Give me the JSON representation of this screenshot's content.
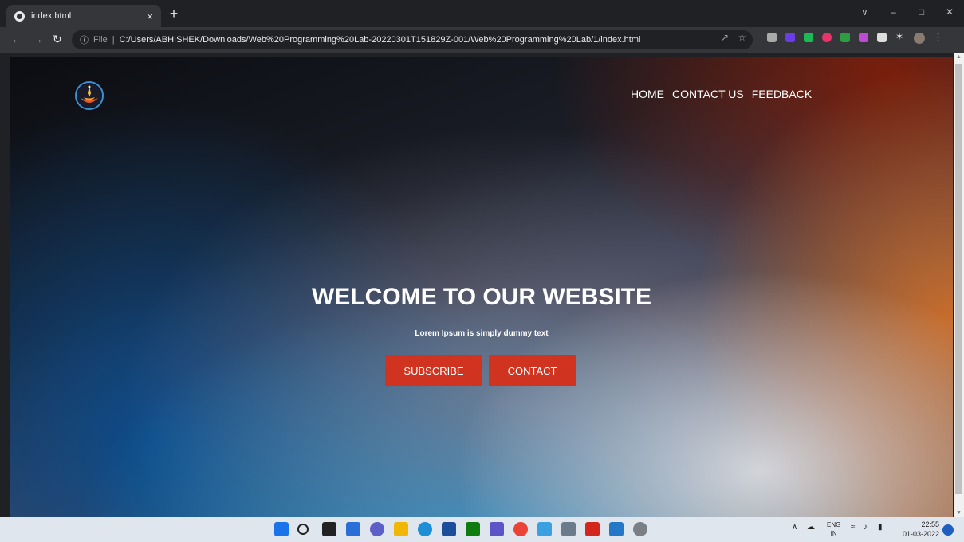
{
  "browser": {
    "tab_title": "index.html",
    "tab_close": "×",
    "new_tab": "+",
    "file_label": "File",
    "url": "C:/Users/ABHISHEK/Downloads/Web%20Programming%20Lab-20220301T151829Z-001/Web%20Programming%20Lab/1/index.html"
  },
  "page": {
    "nav": [
      {
        "label": "HOME"
      },
      {
        "label": "CONTACT US"
      },
      {
        "label": "FEEDBACK"
      }
    ],
    "hero": {
      "title": "WELCOME TO OUR WEBSITE",
      "subtitle": "Lorem Ipsum is simply dummy text",
      "subscribe_label": "SUBSCRIBE",
      "contact_label": "CONTACT"
    },
    "colors": {
      "button": "#d0331f",
      "text": "#ffffff"
    }
  },
  "taskbar": {
    "lang_top": "ENG",
    "lang_bottom": "IN",
    "time": "22:55",
    "date": "01-03-2022"
  }
}
